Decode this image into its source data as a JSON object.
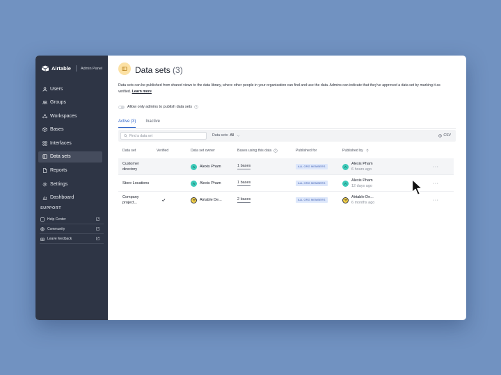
{
  "colors": {
    "background": "#7192c1",
    "sidebar": "#2e3545",
    "accent": "#2d63c8",
    "title_icon_bg": "#fce1a4",
    "avatar": "#3cc9b8"
  },
  "sidebar": {
    "brand_name": "Airtable",
    "panel_label": "Admin Panel",
    "items": [
      {
        "label": "Users",
        "icon": "user-icon"
      },
      {
        "label": "Groups",
        "icon": "group-icon"
      },
      {
        "label": "Workspaces",
        "icon": "workspaces-icon"
      },
      {
        "label": "Bases",
        "icon": "cube-icon"
      },
      {
        "label": "Interfaces",
        "icon": "grid-icon"
      },
      {
        "label": "Data sets",
        "icon": "dataset-icon",
        "active": true
      },
      {
        "label": "Reports",
        "icon": "report-icon"
      },
      {
        "label": "Settings",
        "icon": "gear-icon"
      },
      {
        "label": "Dashboard",
        "icon": "chart-icon"
      }
    ],
    "support_title": "SUPPORT",
    "support_items": [
      {
        "label": "Help Center",
        "icon": "book-icon"
      },
      {
        "label": "Community",
        "icon": "globe-icon"
      },
      {
        "label": "Leave feedback",
        "icon": "gift-icon"
      }
    ]
  },
  "main": {
    "title": "Data sets",
    "count": "(3)",
    "description": "Data sets can be published from shared views to the data library, where other people in your organization can find and use the data. Admins can indicate that they've approved a data set by marking it as verified.",
    "learn_more": "Learn more",
    "toggle_label": "Allow only admins to publish data sets",
    "tabs": [
      {
        "label": "Active (3)",
        "active": true
      },
      {
        "label": "Inactive"
      }
    ],
    "search_placeholder": "Find a data set",
    "filter_label": "Data sets:",
    "filter_value": "All",
    "export_label": "CSV",
    "columns": [
      "Data set",
      "Verified",
      "Data set owner",
      "Bases using this data",
      "Published for",
      "Published by"
    ],
    "rows": [
      {
        "name": "Customer directory",
        "verified": false,
        "owner": "Alexis Pham",
        "owner_initial": "A",
        "bases": "1 bases",
        "published_for": "ALL ORG MEMBERS",
        "publisher": "Alexis Pham",
        "publisher_initial": "A",
        "time": "6 hours ago",
        "more": "···"
      },
      {
        "name": "Store Locations",
        "verified": false,
        "owner": "Alexis Pham",
        "owner_initial": "A",
        "bases": "1 bases",
        "published_for": "ALL ORG MEMBERS",
        "publisher": "Alexis Pham",
        "publisher_initial": "A",
        "time": "12 days ago",
        "more": "···"
      },
      {
        "name": "Company project...",
        "verified": true,
        "owner": "Airtable De...",
        "owner_initial": "",
        "bases": "2 bases",
        "published_for": "ALL ORG MEMBERS",
        "publisher": "Airtable De...",
        "publisher_initial": "",
        "time": "6 months ago",
        "more": "···"
      }
    ]
  }
}
